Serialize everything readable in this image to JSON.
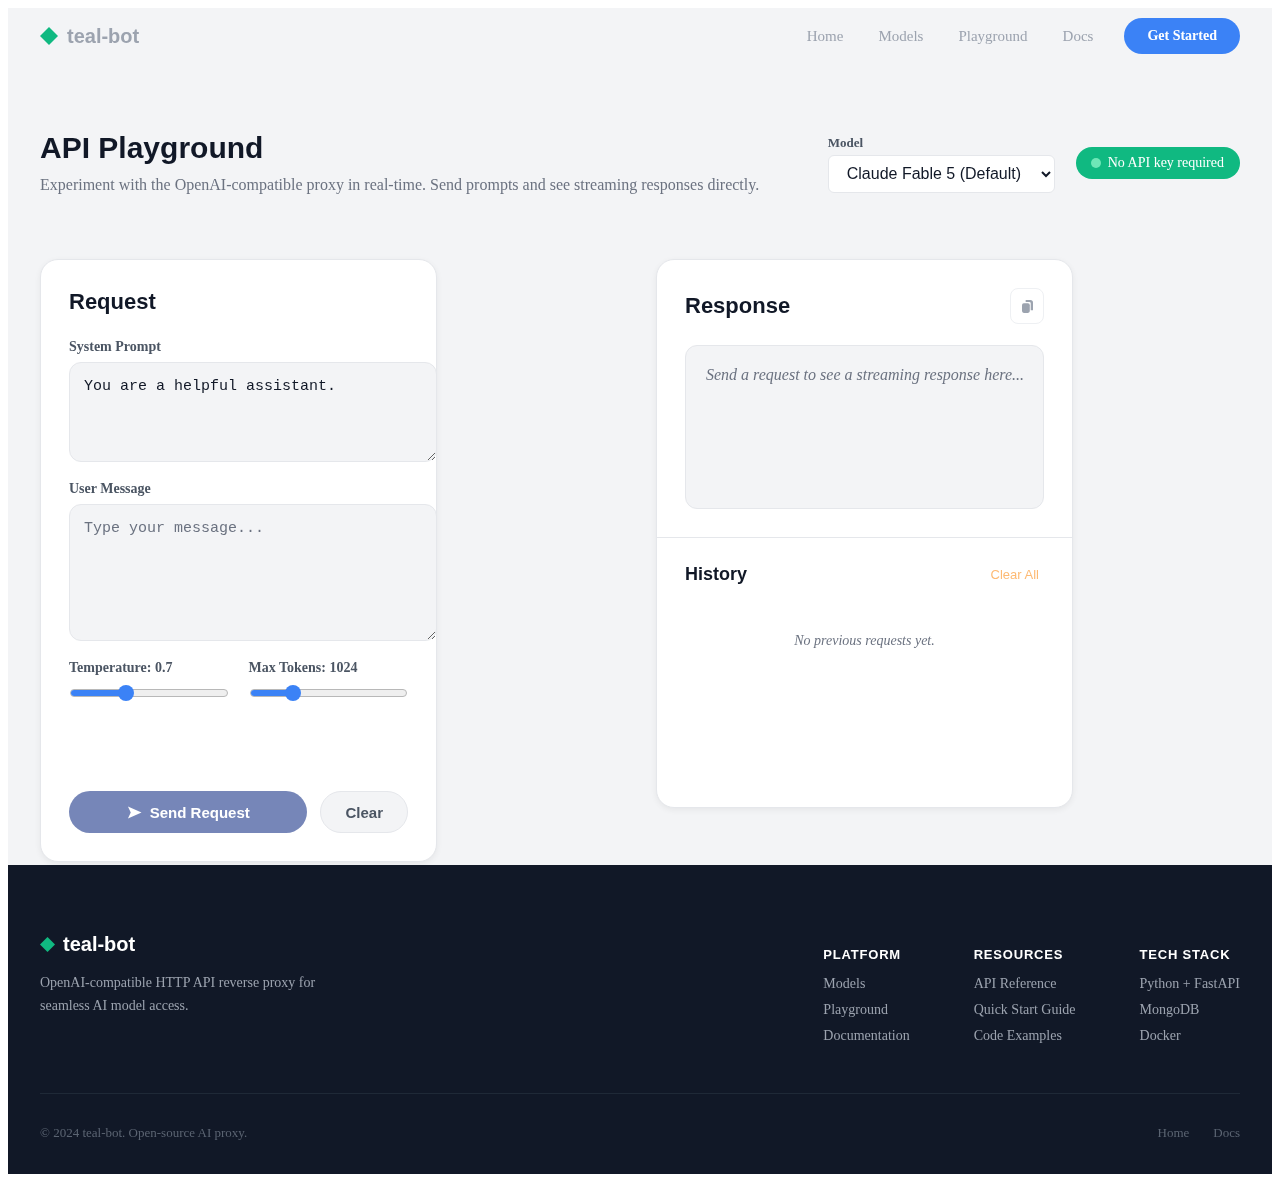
{
  "header": {
    "brand": "teal-bot",
    "nav": [
      {
        "label": "Home"
      },
      {
        "label": "Models"
      },
      {
        "label": "Playground"
      },
      {
        "label": "Docs"
      }
    ],
    "cta": "Get Started"
  },
  "hero": {
    "title": "API Playground",
    "subtitle": "Experiment with the OpenAI-compatible proxy in real-time. Send prompts and see streaming responses directly.",
    "model": {
      "label": "Model",
      "value": "Claude Fable 5 (Default)"
    },
    "badge": "No API key required"
  },
  "request": {
    "title": "Request",
    "fields": [
      {
        "label": "System Prompt",
        "value": "You are a helpful assistant."
      },
      {
        "label": "User Message",
        "placeholder": "Type your message..."
      }
    ],
    "sliders": [
      {
        "label": "Temperature: 0.7",
        "level": 0.36
      },
      {
        "label": "Max Tokens: 1024",
        "level": 0.28
      }
    ],
    "buttons": [
      {
        "kind": "primary",
        "label": "Send Request",
        "disabled": true
      },
      {
        "kind": "secondary",
        "label": "Clear",
        "disabled": false
      }
    ]
  },
  "response": {
    "title": "Response",
    "output_placeholder": "Send a request to see a streaming response here...",
    "history": {
      "title": "History",
      "clear_button": {
        "label": "Clear All",
        "disabled": true
      },
      "empty_text": "No previous requests yet."
    }
  },
  "footer": {
    "brand": "teal-bot",
    "description": "OpenAI-compatible HTTP API reverse proxy for seamless AI model access.",
    "columns": [
      {
        "title": "PLATFORM",
        "links": [
          "Models",
          "Playground",
          "Documentation"
        ]
      },
      {
        "title": "RESOURCES",
        "links": [
          "API Reference",
          "Quick Start Guide",
          "Code Examples"
        ]
      },
      {
        "title": "TECH STACK",
        "links": [
          "Python + FastAPI",
          "MongoDB",
          "Docker"
        ]
      }
    ],
    "copyright": "© 2024 teal-bot. Open-source AI proxy.",
    "bottom_links": [
      "Home",
      "Docs"
    ]
  }
}
